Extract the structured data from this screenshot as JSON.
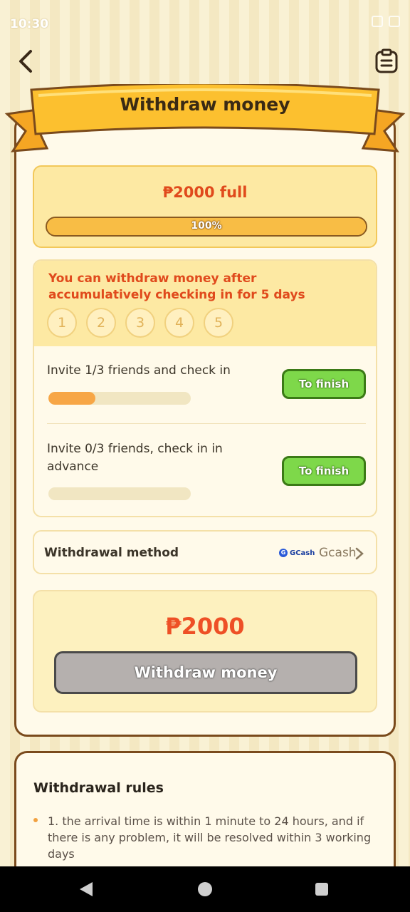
{
  "status_bar": {
    "time": "10:30"
  },
  "header": {
    "title": "Withdraw money"
  },
  "progress_panel": {
    "label": "₱2000 full",
    "percent_text": "100%",
    "percent": 100
  },
  "checkin": {
    "message": "You can withdraw money after accumulatively checking in for 5 days",
    "days": [
      "1",
      "2",
      "3",
      "4",
      "5"
    ]
  },
  "tasks": [
    {
      "label": "Invite 1/3 friends and check in",
      "progress": 0.33,
      "button": "To finish"
    },
    {
      "label": "Invite 0/3 friends, check in in advance",
      "progress": 0,
      "button": "To finish"
    }
  ],
  "withdrawal_method": {
    "label": "Withdrawal method",
    "logo_text": "GCash",
    "value": "Gcash"
  },
  "withdraw": {
    "amount": "₱2000",
    "button": "Withdraw money"
  },
  "rules": {
    "title": "Withdrawal rules",
    "items": [
      "1. the arrival time is within 1 minute to 24 hours, and if there is any problem, it will be resolved within 3 working days"
    ]
  },
  "colors": {
    "accent": "#e04a1c",
    "button_green": "#7ed84a",
    "disabled_gray": "#b5b0ae",
    "card_border": "#7a4a1c"
  }
}
